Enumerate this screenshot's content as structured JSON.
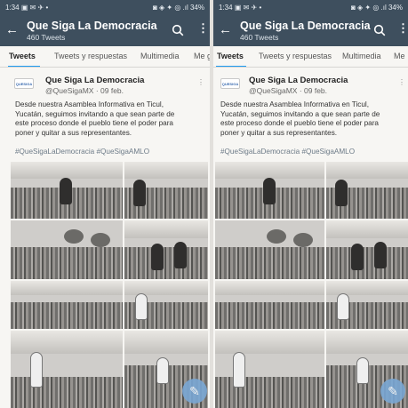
{
  "status": {
    "time": "1:34",
    "left_icons": "▣ ✉ ✈ •",
    "battery": "34%",
    "right_icons": "◙ ◈ ✦ ◎ .ıl"
  },
  "header": {
    "title": "Que Siga La Democracia",
    "subtitle": "460 Tweets"
  },
  "tabs": {
    "tweets": "Tweets",
    "replies": "Tweets y respuestas",
    "media": "Multimedia",
    "likes_left": "Me g",
    "likes_right": "Me"
  },
  "tweet": {
    "avatar_text": "QUESIGA",
    "author": "Que Siga La Democracia",
    "handle": "@QueSigaMX · 09 feb.",
    "lines": [
      "Desde nuestra Asamblea Informativa en Ticul,",
      "Yucatán, seguimos invitando a que sean parte de",
      "este proceso donde el pueblo tiene el poder para",
      "poner y quitar a sus representantes."
    ],
    "hashtags": "#QueSigaLaDemocracia #QueSigaAMLO"
  },
  "icons": {
    "back": "back-arrow-icon",
    "search": "search-icon",
    "more": "more-vertical-icon",
    "compose": "compose-icon"
  },
  "colors": {
    "appbar": "#3e4f5e",
    "tab_underline": "#1d9bf0",
    "fab": "#7aa7d4"
  }
}
